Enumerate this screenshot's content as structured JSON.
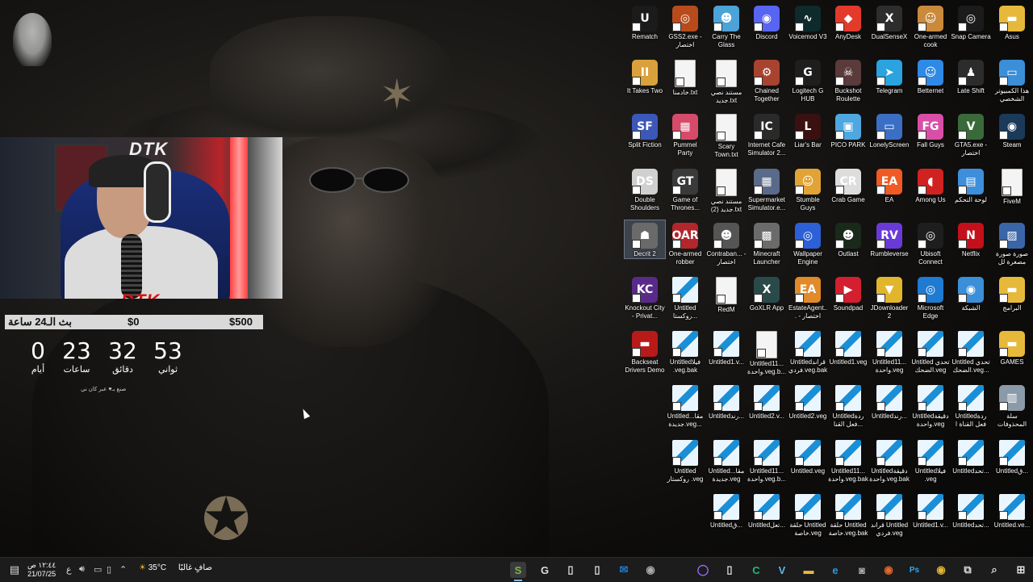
{
  "desktop": {
    "icons": [
      {
        "label": "Rematch",
        "col": 0,
        "row": 0,
        "icon": "rematch-icon",
        "glyph": "U",
        "color": "#1b1b1b"
      },
      {
        "label": "GSS2.exe - اختصار",
        "col": 1,
        "row": 0,
        "icon": "gss2-icon",
        "glyph": "◎",
        "color": "#b84b1c"
      },
      {
        "label": "Carry The Glass",
        "col": 2,
        "row": 0,
        "icon": "carry-the-glass-icon",
        "glyph": "☻",
        "color": "#4ca3d8"
      },
      {
        "label": "Discord",
        "col": 3,
        "row": 0,
        "icon": "discord-icon",
        "glyph": "◉",
        "color": "#5865f2"
      },
      {
        "label": "Voicemod V3",
        "col": 4,
        "row": 0,
        "icon": "voicemod-icon",
        "glyph": "∿",
        "color": "#0f2a2a"
      },
      {
        "label": "AnyDesk",
        "col": 5,
        "row": 0,
        "icon": "anydesk-icon",
        "glyph": "◆",
        "color": "#e33a2c"
      },
      {
        "label": "DualSenseX",
        "col": 6,
        "row": 0,
        "icon": "dualsensex-icon",
        "glyph": "X",
        "color": "#2d2d2d"
      },
      {
        "label": "One-armed cook",
        "col": 7,
        "row": 0,
        "icon": "one-armed-cook-icon",
        "glyph": "☺",
        "color": "#c98a3b"
      },
      {
        "label": "Snap Camera",
        "col": 8,
        "row": 0,
        "icon": "snap-camera-icon",
        "glyph": "◎",
        "color": "#1b1b1b"
      },
      {
        "label": "Asus",
        "col": 9,
        "row": 0,
        "icon": "folder-icon",
        "glyph": "▬",
        "color": "#e7b93a"
      },
      {
        "label": "It Takes Two",
        "col": 0,
        "row": 1,
        "icon": "it-takes-two-icon",
        "glyph": "II",
        "color": "#d9a13b"
      },
      {
        "label": "خادمنا.txt",
        "col": 1,
        "row": 1,
        "icon": "text-file-icon",
        "glyph": "",
        "color": "file"
      },
      {
        "label": "مستند نصي جديد.txt",
        "col": 2,
        "row": 1,
        "icon": "text-file-icon",
        "glyph": "",
        "color": "file"
      },
      {
        "label": "Chained Together",
        "col": 3,
        "row": 1,
        "icon": "chained-together-icon",
        "glyph": "⚙",
        "color": "#a8432f"
      },
      {
        "label": "Logitech G HUB",
        "col": 4,
        "row": 1,
        "icon": "logitech-icon",
        "glyph": "G",
        "color": "#1e1e1e"
      },
      {
        "label": "Buckshot Roulette",
        "col": 5,
        "row": 1,
        "icon": "buckshot-icon",
        "glyph": "☠",
        "color": "#5a3a3a"
      },
      {
        "label": "Telegram",
        "col": 6,
        "row": 1,
        "icon": "telegram-icon",
        "glyph": "➤",
        "color": "#2aa3df"
      },
      {
        "label": "Betternet",
        "col": 7,
        "row": 1,
        "icon": "betternet-icon",
        "glyph": "☺",
        "color": "#2f8ae5"
      },
      {
        "label": "Late Shift",
        "col": 8,
        "row": 1,
        "icon": "late-shift-icon",
        "glyph": "♟",
        "color": "#2c2c2c"
      },
      {
        "label": "هذا الكمبيوتر الشخصي",
        "col": 9,
        "row": 1,
        "icon": "this-pc-icon",
        "glyph": "▭",
        "color": "#3a8fd8"
      },
      {
        "label": "Split Fiction",
        "col": 0,
        "row": 2,
        "icon": "split-fiction-icon",
        "glyph": "SF",
        "color": "#3b57b8"
      },
      {
        "label": "Pummel Party",
        "col": 1,
        "row": 2,
        "icon": "pummel-party-icon",
        "glyph": "▦",
        "color": "#d64a6a"
      },
      {
        "label": "Scary Town.txt",
        "col": 2,
        "row": 2,
        "icon": "text-file-icon",
        "glyph": "",
        "color": "file"
      },
      {
        "label": "Internet Cafe Simulator 2...",
        "col": 3,
        "row": 2,
        "icon": "internet-cafe-icon",
        "glyph": "IC",
        "color": "#2a2a2a"
      },
      {
        "label": "Liar's Bar",
        "col": 4,
        "row": 2,
        "icon": "liars-bar-icon",
        "glyph": "L",
        "color": "#3a1010"
      },
      {
        "label": "PICO PARK",
        "col": 5,
        "row": 2,
        "icon": "pico-park-icon",
        "glyph": "▣",
        "color": "#4fa7e0"
      },
      {
        "label": "LonelyScreen",
        "col": 6,
        "row": 2,
        "icon": "lonelyscreen-icon",
        "glyph": "▭",
        "color": "#3b6fc6"
      },
      {
        "label": "Fall Guys",
        "col": 7,
        "row": 2,
        "icon": "fall-guys-icon",
        "glyph": "FG",
        "color": "#d94fa8"
      },
      {
        "label": "GTA5.exe - اختصار",
        "col": 8,
        "row": 2,
        "icon": "gta5-icon",
        "glyph": "V",
        "color": "#3a6a3a"
      },
      {
        "label": "Steam",
        "col": 9,
        "row": 2,
        "icon": "steam-icon",
        "glyph": "◉",
        "color": "#1b3a5a"
      },
      {
        "label": "Double Shoulders",
        "col": 0,
        "row": 3,
        "icon": "double-shoulders-icon",
        "glyph": "DS",
        "color": "#d0d0d0"
      },
      {
        "label": "Game of Thrones...",
        "col": 1,
        "row": 3,
        "icon": "game-of-thrones-icon",
        "glyph": "GT",
        "color": "#3a3a3a"
      },
      {
        "label": "مستند نصي جديد (2).txt",
        "col": 2,
        "row": 3,
        "icon": "text-file-icon",
        "glyph": "",
        "color": "file"
      },
      {
        "label": "Supermarket Simulator.e...",
        "col": 3,
        "row": 3,
        "icon": "supermarket-icon",
        "glyph": "▦",
        "color": "#5a6a8a"
      },
      {
        "label": "Stumble Guys",
        "col": 4,
        "row": 3,
        "icon": "stumble-guys-icon",
        "glyph": "☺",
        "color": "#e1a336"
      },
      {
        "label": "Crab Game",
        "col": 5,
        "row": 3,
        "icon": "crab-game-icon",
        "glyph": "CR",
        "color": "#dddddd"
      },
      {
        "label": "EA",
        "col": 6,
        "row": 3,
        "icon": "ea-icon",
        "glyph": "EA",
        "color": "#f05a23"
      },
      {
        "label": "Among Us",
        "col": 7,
        "row": 3,
        "icon": "among-us-icon",
        "glyph": "◖",
        "color": "#d12222"
      },
      {
        "label": "لوحة التحكم",
        "col": 8,
        "row": 3,
        "icon": "control-panel-icon",
        "glyph": "▤",
        "color": "#3d8fdb"
      },
      {
        "label": "FiveM",
        "col": 9,
        "row": 3,
        "icon": "text-file-icon",
        "glyph": "",
        "color": "file"
      },
      {
        "label": "Decrit 2",
        "col": 0,
        "row": 4,
        "icon": "decrit-icon",
        "glyph": "☗",
        "color": "#6a6a6a",
        "selected": true
      },
      {
        "label": "One-armed robber",
        "col": 1,
        "row": 4,
        "icon": "one-armed-robber-icon",
        "glyph": "OAR",
        "color": "#b3262b"
      },
      {
        "label": "Contraban... - اختصار",
        "col": 2,
        "row": 4,
        "icon": "contraband-icon",
        "glyph": "☻",
        "color": "#555"
      },
      {
        "label": "Minecraft Launcher",
        "col": 3,
        "row": 4,
        "icon": "minecraft-icon",
        "glyph": "▩",
        "color": "#6b6b6b"
      },
      {
        "label": "Wallpaper Engine",
        "col": 4,
        "row": 4,
        "icon": "wallpaper-engine-icon",
        "glyph": "◎",
        "color": "#2d5fd6"
      },
      {
        "label": "Outlast",
        "col": 5,
        "row": 4,
        "icon": "outlast-icon",
        "glyph": "☻",
        "color": "#1a2a1a"
      },
      {
        "label": "Rumbleverse",
        "col": 6,
        "row": 4,
        "icon": "rumbleverse-icon",
        "glyph": "RV",
        "color": "#6a3ad8"
      },
      {
        "label": "Ubisoft Connect",
        "col": 7,
        "row": 4,
        "icon": "ubisoft-icon",
        "glyph": "◎",
        "color": "#1e1e1e"
      },
      {
        "label": "Netflix",
        "col": 8,
        "row": 4,
        "icon": "netflix-icon",
        "glyph": "N",
        "color": "#c4101a"
      },
      {
        "label": "صورة صورة مصغرة لل",
        "col": 9,
        "row": 4,
        "icon": "image-file-icon",
        "glyph": "▨",
        "color": "#3a66a8"
      },
      {
        "label": "Knockout City - Privat...",
        "col": 0,
        "row": 5,
        "icon": "knockout-city-icon",
        "glyph": "KC",
        "color": "#5a2a8a"
      },
      {
        "label": "Untitled روكستا...",
        "col": 1,
        "row": 5,
        "icon": "vegas-file-icon",
        "glyph": "",
        "color": "veg"
      },
      {
        "label": "RedM",
        "col": 2,
        "row": 5,
        "icon": "text-file-icon",
        "glyph": "",
        "color": "file"
      },
      {
        "label": "GoXLR App",
        "col": 3,
        "row": 5,
        "icon": "goxlr-icon",
        "glyph": "X",
        "color": "#2a4a4a"
      },
      {
        "label": "EstateAgent... - اختصار",
        "col": 4,
        "row": 5,
        "icon": "estate-agent-icon",
        "glyph": "EA",
        "color": "#e08a2a"
      },
      {
        "label": "Soundpad",
        "col": 5,
        "row": 5,
        "icon": "soundpad-icon",
        "glyph": "▶",
        "color": "#d31f2f"
      },
      {
        "label": "JDownloader 2",
        "col": 6,
        "row": 5,
        "icon": "jdownloader-icon",
        "glyph": "▼",
        "color": "#e2b62a"
      },
      {
        "label": "Microsoft Edge",
        "col": 7,
        "row": 5,
        "icon": "edge-icon",
        "glyph": "◎",
        "color": "#1f7ad1"
      },
      {
        "label": "الشبكة",
        "col": 8,
        "row": 5,
        "icon": "network-icon",
        "glyph": "◉",
        "color": "#3a8fd8"
      },
      {
        "label": "البرامج",
        "col": 9,
        "row": 5,
        "icon": "folder-icon",
        "glyph": "▬",
        "color": "#e7b93a"
      },
      {
        "label": "Backseat Drivers Demo",
        "col": 0,
        "row": 6,
        "icon": "backseat-drivers-icon",
        "glyph": "▬",
        "color": "#b81a1a"
      },
      {
        "label": "Untitledفيلا .veg.bak",
        "col": 1,
        "row": 6,
        "icon": "vegas-file-icon",
        "glyph": "",
        "color": "veg"
      },
      {
        "label": "Untitled1.v...",
        "col": 2,
        "row": 6,
        "icon": "vegas-file-icon",
        "glyph": "",
        "color": "veg"
      },
      {
        "label": "Untitled11... واحدة.veg.b...",
        "col": 3,
        "row": 6,
        "icon": "text-file-icon",
        "glyph": "",
        "color": "file"
      },
      {
        "label": "Untitledقراند فردي.veg.bak",
        "col": 4,
        "row": 6,
        "icon": "vegas-file-icon",
        "glyph": "",
        "color": "veg"
      },
      {
        "label": "Untitled1.veg",
        "col": 5,
        "row": 6,
        "icon": "vegas-file-icon",
        "glyph": "",
        "color": "veg"
      },
      {
        "label": "Untitled11... واحدة.veg",
        "col": 6,
        "row": 6,
        "icon": "vegas-file-icon",
        "glyph": "",
        "color": "veg"
      },
      {
        "label": "Untitled تحدي الضحك.veg",
        "col": 7,
        "row": 6,
        "icon": "vegas-file-icon",
        "glyph": "",
        "color": "veg"
      },
      {
        "label": "Untitled تحدي الضحك.veg...",
        "col": 8,
        "row": 6,
        "icon": "vegas-file-icon",
        "glyph": "",
        "color": "veg"
      },
      {
        "label": "GAMES",
        "col": 9,
        "row": 6,
        "icon": "folder-icon",
        "glyph": "▬",
        "color": "#e7b93a"
      },
      {
        "label": "Untitledمقا... جديدة.veg...",
        "col": 1,
        "row": 7,
        "icon": "vegas-file-icon",
        "glyph": "",
        "color": "veg"
      },
      {
        "label": "Untitledرند...",
        "col": 2,
        "row": 7,
        "icon": "vegas-file-icon",
        "glyph": "",
        "color": "veg"
      },
      {
        "label": "Untitled2.v...",
        "col": 3,
        "row": 7,
        "icon": "vegas-file-icon",
        "glyph": "",
        "color": "veg"
      },
      {
        "label": "Untitled2.veg",
        "col": 4,
        "row": 7,
        "icon": "vegas-file-icon",
        "glyph": "",
        "color": "veg"
      },
      {
        "label": "Untitledردة فعل القنا...",
        "col": 5,
        "row": 7,
        "icon": "vegas-file-icon",
        "glyph": "",
        "color": "veg"
      },
      {
        "label": "Untitledرند...",
        "col": 6,
        "row": 7,
        "icon": "vegas-file-icon",
        "glyph": "",
        "color": "veg"
      },
      {
        "label": "Untitledدقيقة واحدة.veg",
        "col": 7,
        "row": 7,
        "icon": "vegas-file-icon",
        "glyph": "",
        "color": "veg"
      },
      {
        "label": "Untitledردة فعل القناة ا",
        "col": 8,
        "row": 7,
        "icon": "vegas-file-icon",
        "glyph": "",
        "color": "veg"
      },
      {
        "label": "سلة المحذوفات",
        "col": 9,
        "row": 7,
        "icon": "recycle-bin-icon",
        "glyph": "▥",
        "color": "#8a9aa8"
      },
      {
        "label": "Untitled روكستار .veg",
        "col": 1,
        "row": 8,
        "icon": "vegas-file-icon",
        "glyph": "",
        "color": "veg"
      },
      {
        "label": "Untitledمقا... جديدة.veg",
        "col": 2,
        "row": 8,
        "icon": "vegas-file-icon",
        "glyph": "",
        "color": "veg"
      },
      {
        "label": "Untitled11... واحدة.veg.b...",
        "col": 3,
        "row": 8,
        "icon": "vegas-file-icon",
        "glyph": "",
        "color": "veg"
      },
      {
        "label": "Untitled.veg",
        "col": 4,
        "row": 8,
        "icon": "vegas-file-icon",
        "glyph": "",
        "color": "veg"
      },
      {
        "label": "Untitled11... واحدة.veg.bak",
        "col": 5,
        "row": 8,
        "icon": "vegas-file-icon",
        "glyph": "",
        "color": "veg"
      },
      {
        "label": "Untitledدقيقة واحدة.veg.bak",
        "col": 6,
        "row": 8,
        "icon": "vegas-file-icon",
        "glyph": "",
        "color": "veg"
      },
      {
        "label": "Untitledفيلا .veg",
        "col": 7,
        "row": 8,
        "icon": "vegas-file-icon",
        "glyph": "",
        "color": "veg"
      },
      {
        "label": "Untitledتحد...",
        "col": 8,
        "row": 8,
        "icon": "vegas-file-icon",
        "glyph": "",
        "color": "veg"
      },
      {
        "label": "Untitledق...",
        "col": 9,
        "row": 8,
        "icon": "vegas-file-icon",
        "glyph": "",
        "color": "veg"
      },
      {
        "label": "Untitledق...",
        "col": 2,
        "row": 9,
        "icon": "vegas-file-icon",
        "glyph": "",
        "color": "veg"
      },
      {
        "label": "Untitledتعل...",
        "col": 3,
        "row": 9,
        "icon": "vegas-file-icon",
        "glyph": "",
        "color": "veg"
      },
      {
        "label": "حلقة Untitled خاصة.veg",
        "col": 4,
        "row": 9,
        "icon": "vegas-file-icon",
        "glyph": "",
        "color": "veg"
      },
      {
        "label": "حلقة Untitled خاصة.veg.bak",
        "col": 5,
        "row": 9,
        "icon": "vegas-file-icon",
        "glyph": "",
        "color": "veg"
      },
      {
        "label": "قراند Untitled فردي.veg",
        "col": 6,
        "row": 9,
        "icon": "vegas-file-icon",
        "glyph": "",
        "color": "veg"
      },
      {
        "label": "Untitled1.v...",
        "col": 7,
        "row": 9,
        "icon": "vegas-file-icon",
        "glyph": "",
        "color": "veg"
      },
      {
        "label": "Untitledتحد...",
        "col": 8,
        "row": 9,
        "icon": "vegas-file-icon",
        "glyph": "",
        "color": "veg"
      },
      {
        "label": "Untitled.ve...",
        "col": 9,
        "row": 9,
        "icon": "vegas-file-icon",
        "glyph": "",
        "color": "veg"
      }
    ]
  },
  "overlay": {
    "bar_title": "بث الـ24 ساعة",
    "bar_current": "$0",
    "bar_goal": "$500",
    "timer": [
      {
        "value": "0",
        "label": "أيام"
      },
      {
        "value": "23",
        "label": "ساعات"
      },
      {
        "value": "32",
        "label": "دقائق"
      },
      {
        "value": "53",
        "label": "ثواني"
      }
    ],
    "credit": "صنع بـ♥ عبر كان ني",
    "cam_logo": "DTK"
  },
  "taskbar": {
    "clock_time": "١٢:٤٤ ص",
    "clock_date": "21/07/25",
    "lang": "ع",
    "temperature": "35°C",
    "weather_text": "صافٍ غالبًا",
    "apps": [
      {
        "name": "taskbar-app-snagit",
        "glyph": "S",
        "color": "#7ab648",
        "active": true
      },
      {
        "name": "taskbar-app-logitech",
        "glyph": "G",
        "color": "#ddd"
      },
      {
        "name": "taskbar-app-file-1",
        "glyph": "▯",
        "color": "#ddd"
      },
      {
        "name": "taskbar-app-file-2",
        "glyph": "▯",
        "color": "#ddd"
      },
      {
        "name": "taskbar-app-outlook",
        "glyph": "✉",
        "color": "#1f7ad1"
      },
      {
        "name": "taskbar-app-obs",
        "glyph": "◉",
        "color": "#aaa"
      },
      {
        "name": "taskbar-app-cortana",
        "glyph": "◯",
        "color": "#9a6aff"
      },
      {
        "name": "taskbar-app-file-3",
        "glyph": "▯",
        "color": "#ddd"
      },
      {
        "name": "taskbar-app-camtasia",
        "glyph": "C",
        "color": "#2fb37a"
      },
      {
        "name": "taskbar-app-vegas",
        "glyph": "V",
        "color": "#5ab7e8"
      },
      {
        "name": "taskbar-app-explorer",
        "glyph": "▬",
        "color": "#e7b93a"
      },
      {
        "name": "taskbar-app-edge",
        "glyph": "e",
        "color": "#2b9bd8"
      },
      {
        "name": "taskbar-app-gamepad",
        "glyph": "◙",
        "color": "#aaa"
      },
      {
        "name": "taskbar-app-firefox",
        "glyph": "◉",
        "color": "#e8672a"
      },
      {
        "name": "taskbar-app-photoshop",
        "glyph": "Ps",
        "color": "#31a8ff"
      },
      {
        "name": "taskbar-app-chrome",
        "glyph": "◉",
        "color": "#e4b533"
      },
      {
        "name": "taskbar-app-task-view",
        "glyph": "⧉",
        "color": "#ddd"
      },
      {
        "name": "taskbar-app-search",
        "glyph": "⌕",
        "color": "#ddd"
      },
      {
        "name": "taskbar-app-start",
        "glyph": "⊞",
        "color": "#ddd"
      }
    ]
  }
}
